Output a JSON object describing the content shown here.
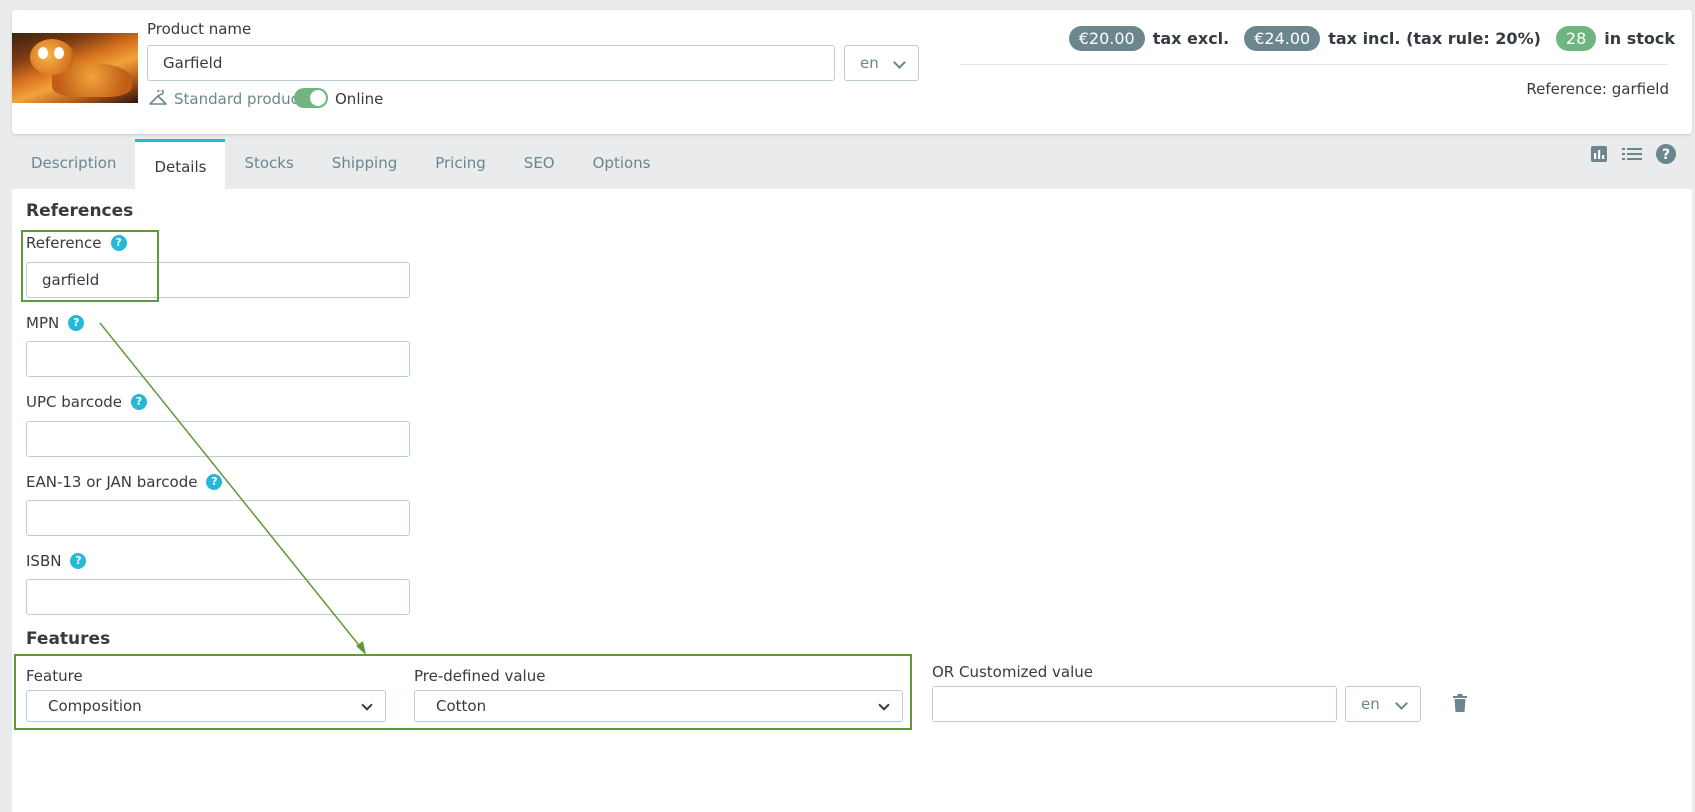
{
  "header": {
    "product_name_label": "Product name",
    "product_name_value": "Garfield",
    "lang": "en",
    "product_type": "Standard product",
    "online_label": "Online",
    "price_excl": "€20.00",
    "price_excl_label": "tax excl.",
    "price_incl": "€24.00",
    "price_incl_label": "tax incl. (tax rule: 20%)",
    "stock_qty": "28",
    "stock_label": "in stock",
    "reference_summary": "Reference: garfield"
  },
  "tabs": [
    {
      "label": "Description"
    },
    {
      "label": "Details"
    },
    {
      "label": "Stocks"
    },
    {
      "label": "Shipping"
    },
    {
      "label": "Pricing"
    },
    {
      "label": "SEO"
    },
    {
      "label": "Options"
    }
  ],
  "references": {
    "title": "References",
    "fields": [
      {
        "label": "Reference",
        "value": "garfield"
      },
      {
        "label": "MPN",
        "value": ""
      },
      {
        "label": "UPC barcode",
        "value": ""
      },
      {
        "label": "EAN-13 or JAN barcode",
        "value": ""
      },
      {
        "label": "ISBN",
        "value": ""
      }
    ]
  },
  "features": {
    "title": "Features",
    "feature_label": "Feature",
    "feature_value": "Composition",
    "predefined_label": "Pre-defined value",
    "predefined_value": "Cotton",
    "custom_label": "OR Customized value",
    "custom_value": "",
    "custom_lang": "en"
  },
  "help_glyph": "?",
  "colors": {
    "accent": "#25b9d7",
    "success": "#70b580",
    "pill": "#6c868e",
    "annotation": "#5f9a3a"
  }
}
